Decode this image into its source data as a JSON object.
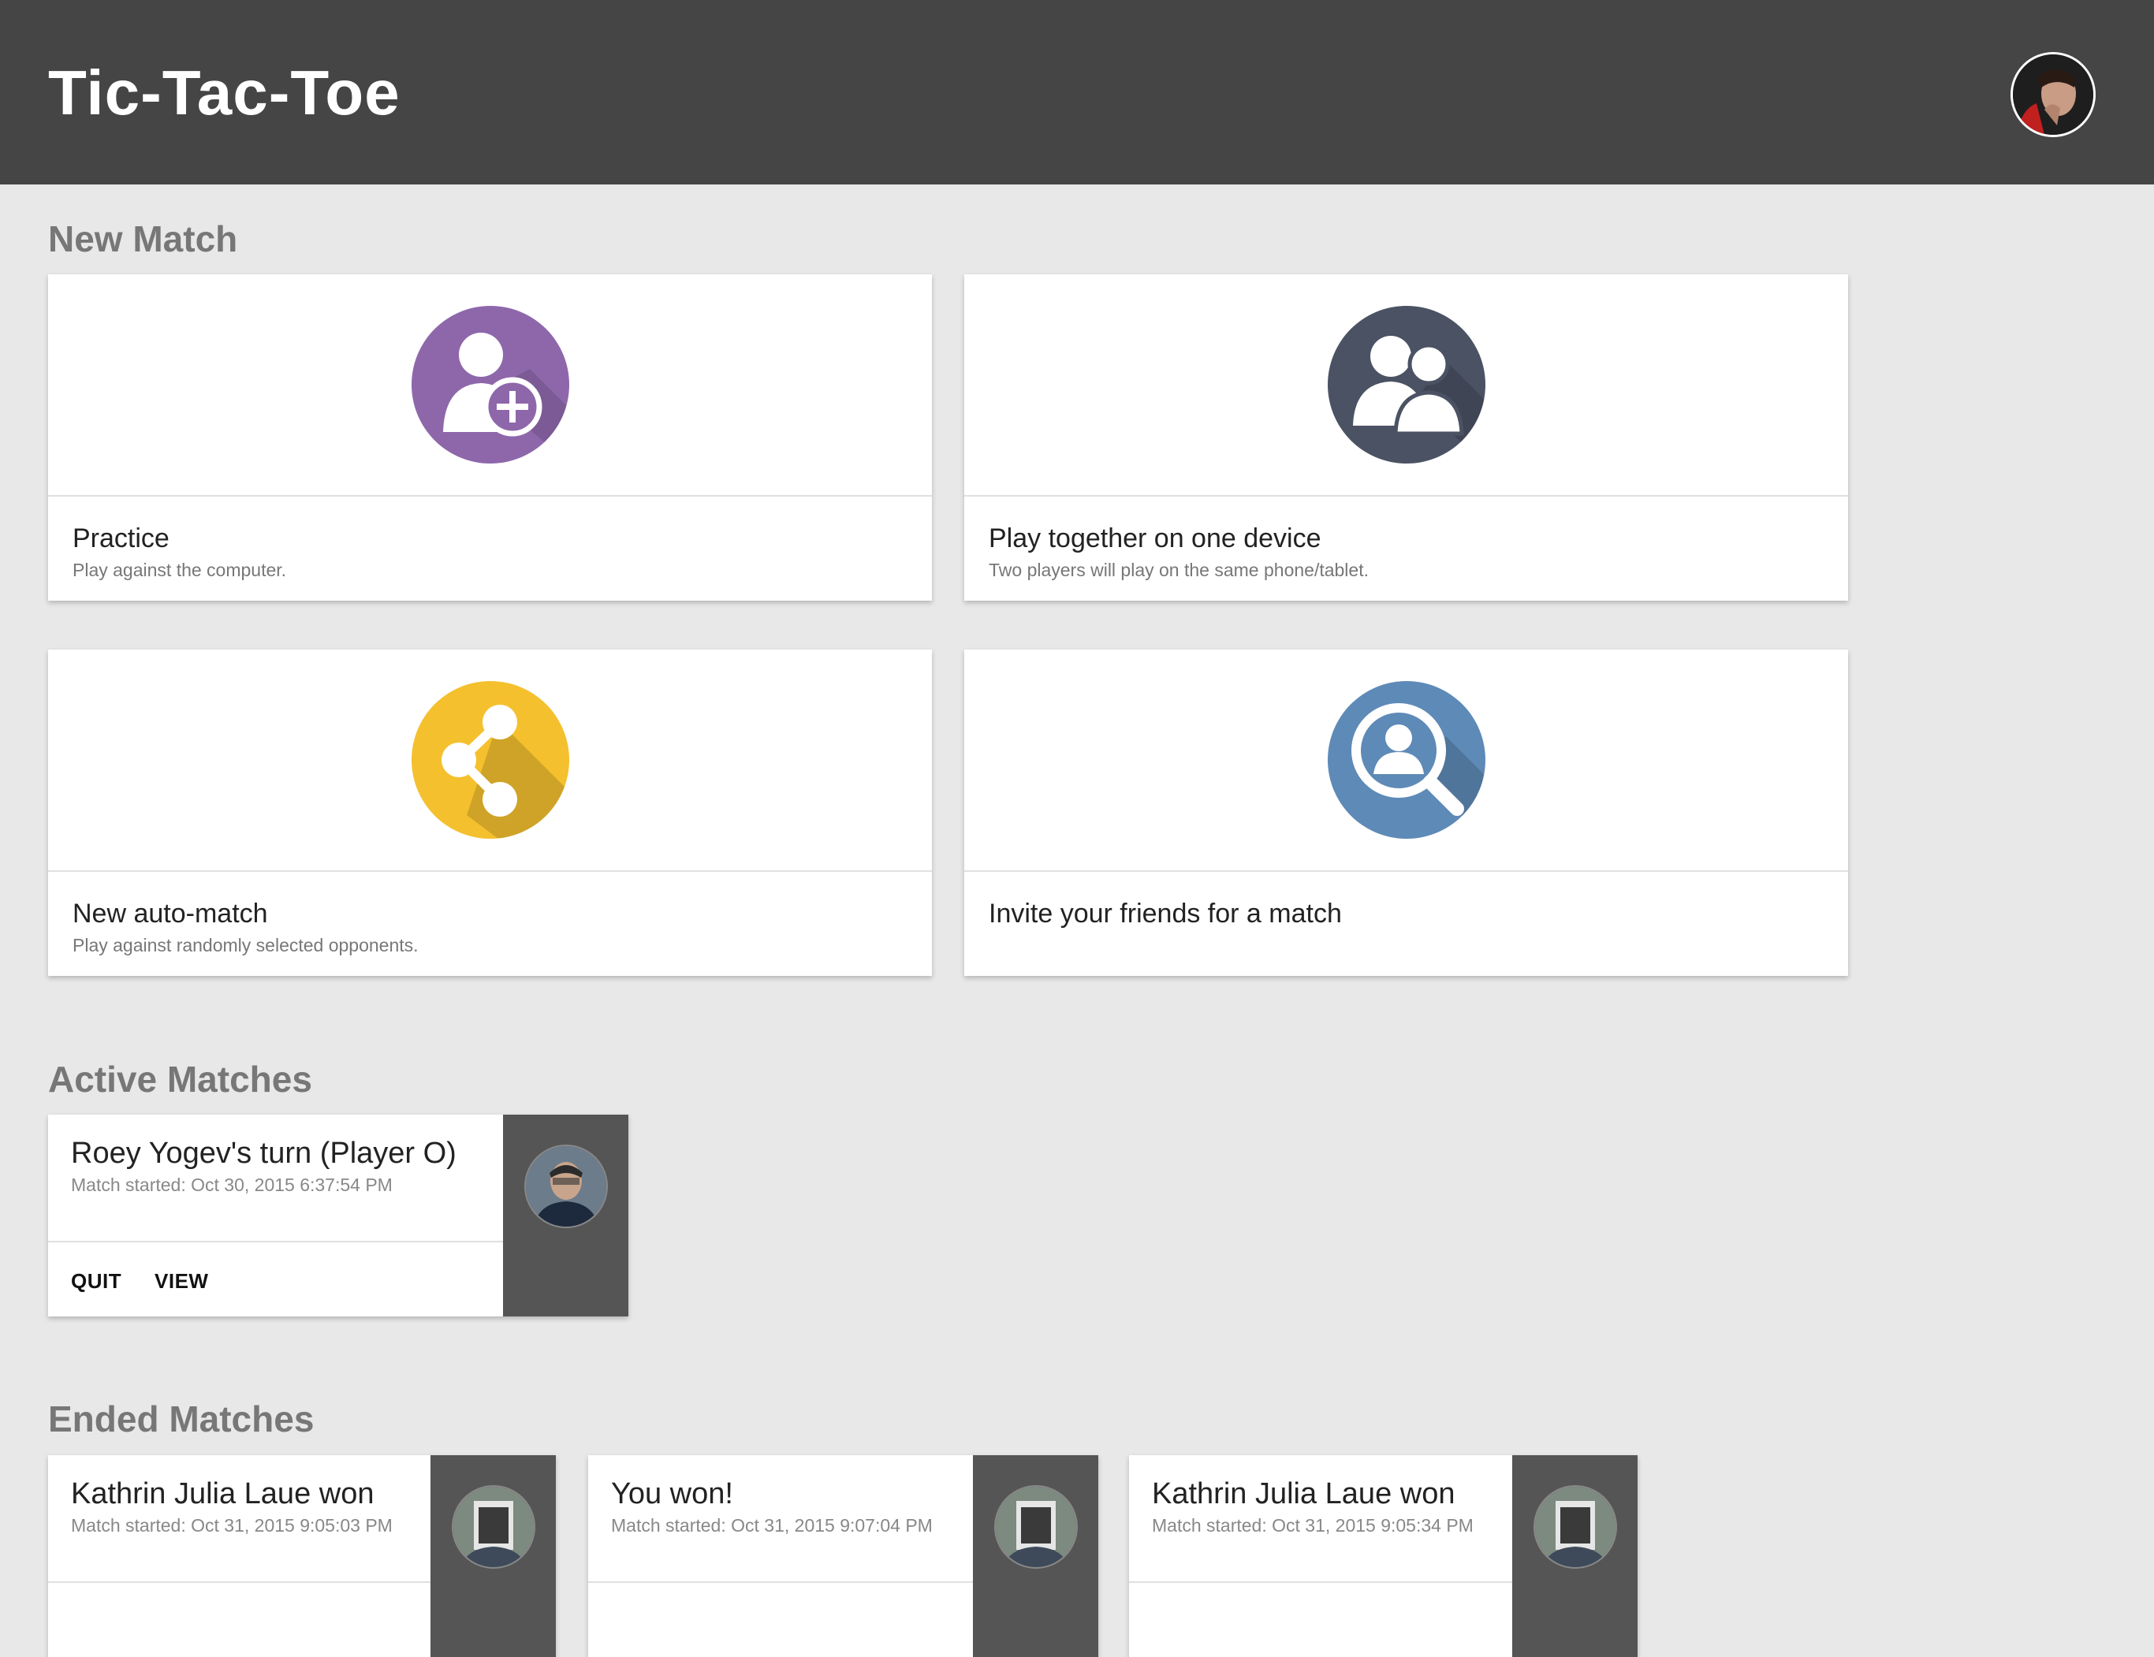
{
  "app": {
    "title": "Tic-Tac-Toe"
  },
  "new_match": {
    "heading": "New Match",
    "cards": [
      {
        "title": "Practice",
        "subtitle": "Play against the computer.",
        "icon": "add-person-icon",
        "color": "#8e67ab"
      },
      {
        "title": "Play together on one device",
        "subtitle": "Two players will play on the same phone/tablet.",
        "icon": "two-people-icon",
        "color": "#4a5263"
      },
      {
        "title": "New auto-match",
        "subtitle": "Play against randomly selected opponents.",
        "icon": "share-icon",
        "color": "#f4c02e"
      },
      {
        "title": "Invite your friends for a match",
        "subtitle": "",
        "icon": "search-person-icon",
        "color": "#5e8ab7"
      }
    ]
  },
  "active_matches": {
    "heading": "Active Matches",
    "items": [
      {
        "title": "Roey Yogev's turn (Player O)",
        "subtitle": "Match started: Oct 30, 2015 6:37:54 PM",
        "quit": "QUIT",
        "view": "VIEW"
      }
    ]
  },
  "ended_matches": {
    "heading": "Ended Matches",
    "items": [
      {
        "title": "Kathrin Julia Laue won",
        "subtitle": "Match started: Oct 31, 2015 9:05:03 PM"
      },
      {
        "title": "You won!",
        "subtitle": "Match started: Oct 31, 2015 9:07:04 PM"
      },
      {
        "title": "Kathrin Julia Laue won",
        "subtitle": "Match started: Oct 31, 2015 9:05:34 PM"
      }
    ]
  }
}
